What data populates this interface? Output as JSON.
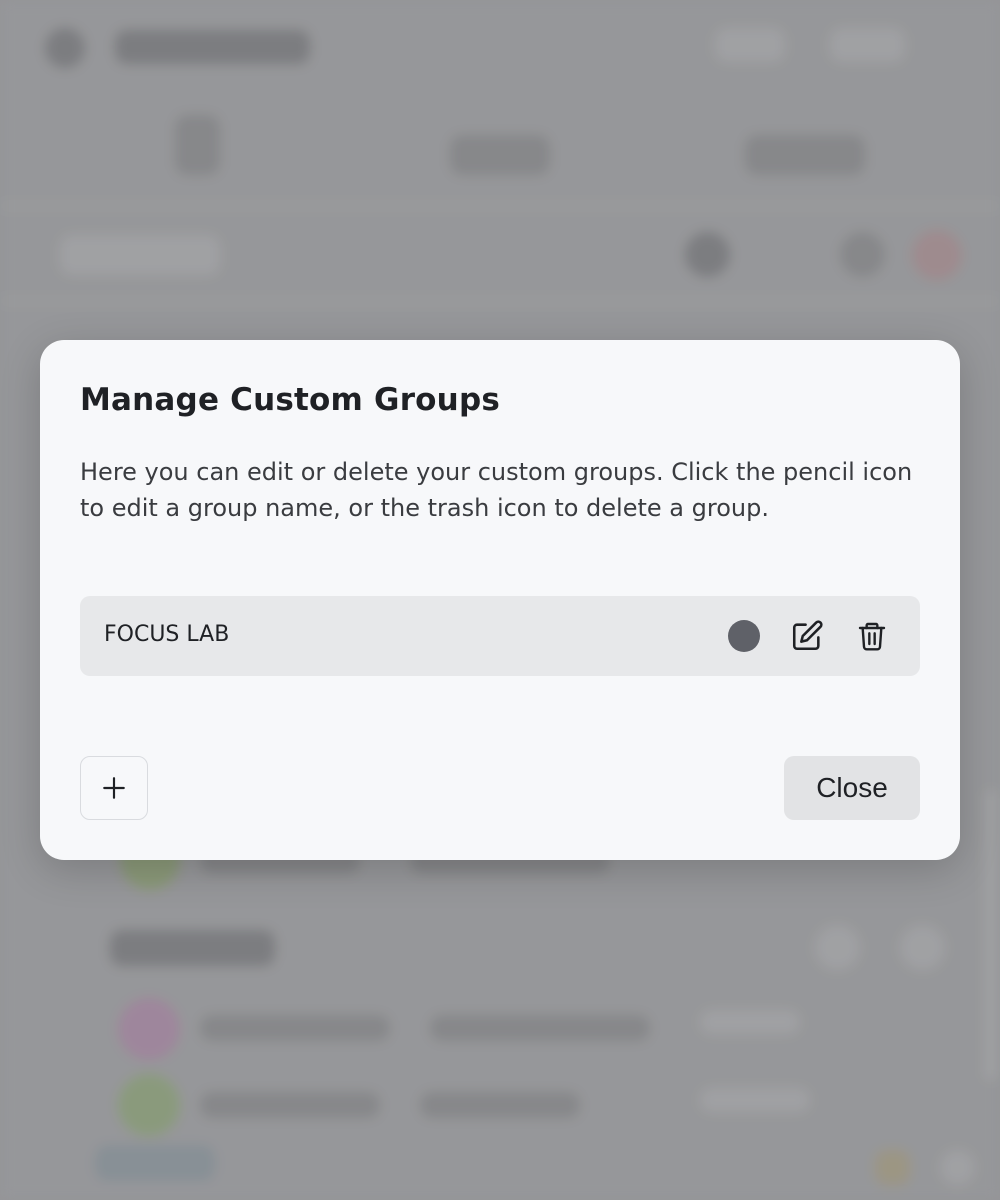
{
  "modal": {
    "title": "Manage Custom Groups",
    "description": "Here you can edit or delete your custom groups. Click the pencil icon to edit a group name, or the trash icon to delete a group.",
    "groups": [
      {
        "name": "FOCUS LAB",
        "color": "#5f6168"
      }
    ],
    "add_icon": "plus-icon",
    "close_label": "Close"
  },
  "icons": {
    "edit": "pencil-square-icon",
    "delete": "trash-icon"
  },
  "colors": {
    "modal_background": "#f7f8fa",
    "row_background": "#e7e8ea",
    "close_button_background": "#e2e3e5"
  }
}
